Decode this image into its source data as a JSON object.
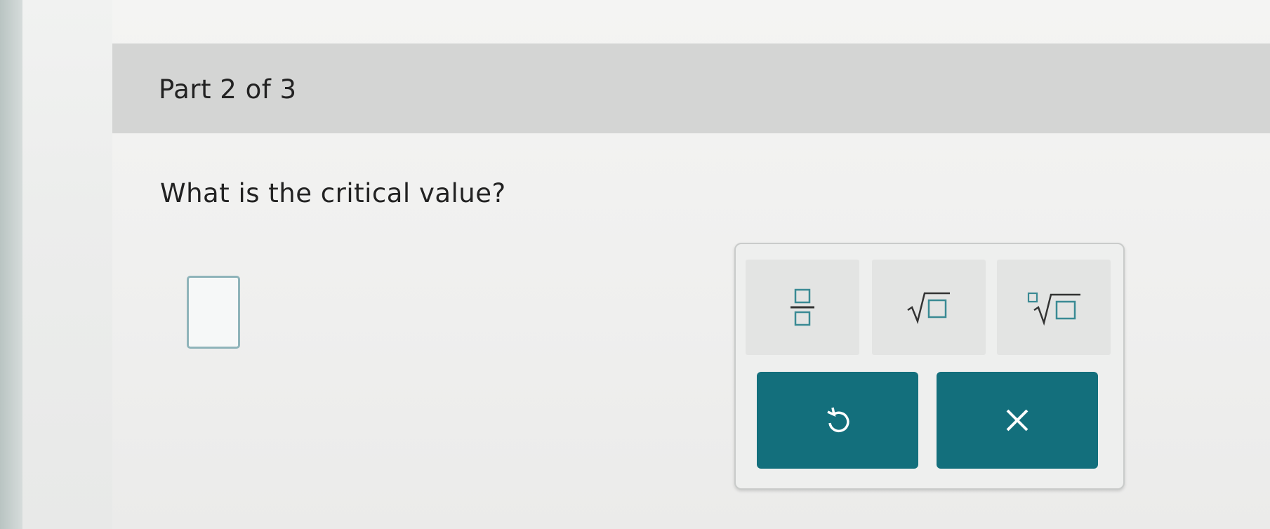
{
  "header": {
    "part_label": "Part 2 of 3"
  },
  "question": {
    "text": "What is the critical value?"
  },
  "answer": {
    "value": ""
  },
  "palette": {
    "tools": [
      {
        "icon": "fraction-icon"
      },
      {
        "icon": "square-root-icon"
      },
      {
        "icon": "nth-root-icon"
      }
    ],
    "actions": [
      {
        "icon": "undo-icon"
      },
      {
        "icon": "clear-icon"
      }
    ]
  },
  "colors": {
    "accent": "#136f7c",
    "input_border": "#8fb4ba",
    "bar_background": "#d4d5d4"
  }
}
